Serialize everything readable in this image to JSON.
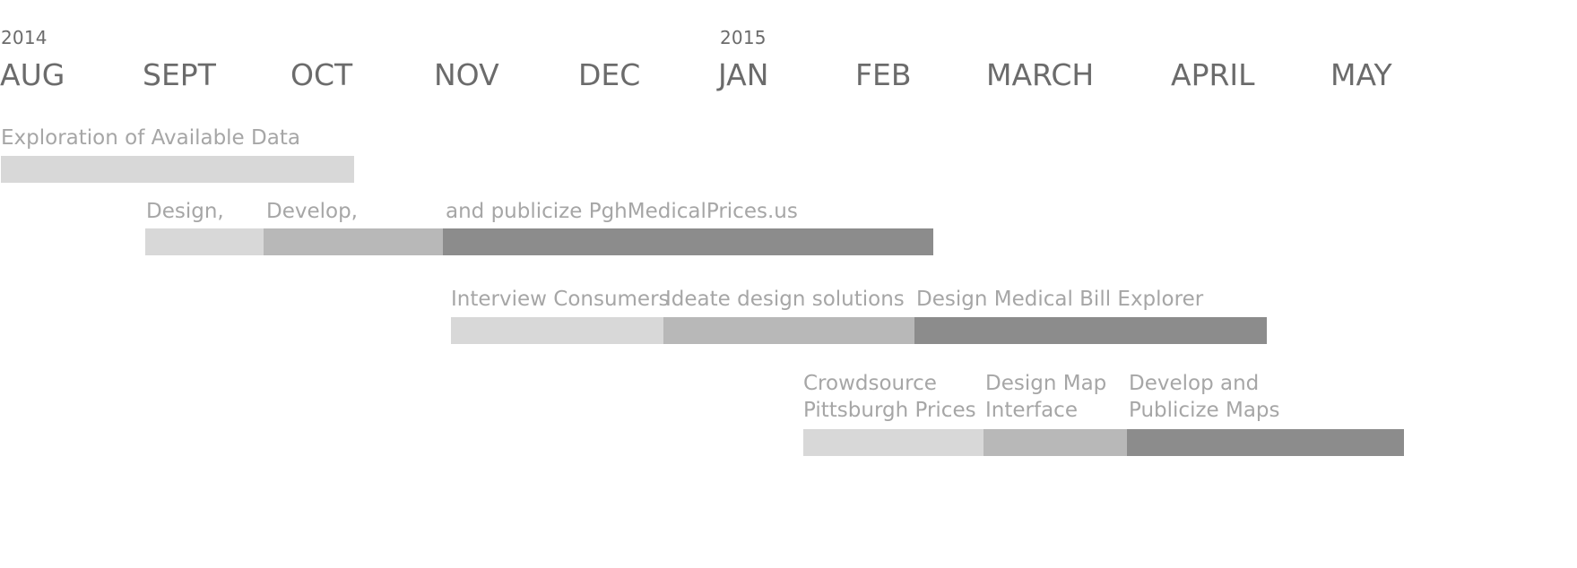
{
  "chart_data": {
    "type": "gantt",
    "years": [
      {
        "label": "2014",
        "month_index": 0
      },
      {
        "label": "2015",
        "month_index": 5
      }
    ],
    "months": [
      "AUG",
      "SEPT",
      "OCT",
      "NOV",
      "DEC",
      "JAN",
      "FEB",
      "MARCH",
      "APRIL",
      "MAY"
    ],
    "phase_colors": {
      "light": "#d8d8d8",
      "medium": "#b8b8b8",
      "dark": "#8c8c8c"
    },
    "tracks": [
      {
        "segments": [
          {
            "label": "Exploration of Available Data",
            "start": 0.0,
            "end": 2.45,
            "phase": "light"
          }
        ]
      },
      {
        "segments": [
          {
            "label": "Design,",
            "start": 1.0,
            "end": 1.82,
            "phase": "light"
          },
          {
            "label": "Develop,",
            "start": 1.82,
            "end": 3.06,
            "phase": "medium"
          },
          {
            "label": "and publicize PghMedicalPrices.us",
            "start": 3.06,
            "end": 6.46,
            "phase": "dark"
          }
        ]
      },
      {
        "segments": [
          {
            "label": "Interview Consumers",
            "start": 3.12,
            "end": 4.59,
            "phase": "light"
          },
          {
            "label": "Ideate design solutions",
            "start": 4.59,
            "end": 6.33,
            "phase": "medium"
          },
          {
            "label": "Design Medical Bill Explorer",
            "start": 6.33,
            "end": 8.77,
            "phase": "dark"
          }
        ]
      },
      {
        "segments": [
          {
            "label": "Crowdsource\nPittsburgh Prices",
            "start": 5.56,
            "end": 6.81,
            "phase": "light"
          },
          {
            "label": "Design Map\nInterface",
            "start": 6.81,
            "end": 7.8,
            "phase": "medium"
          },
          {
            "label": "Develop and\nPublicize Maps",
            "start": 7.8,
            "end": 9.72,
            "phase": "dark"
          }
        ]
      }
    ]
  }
}
